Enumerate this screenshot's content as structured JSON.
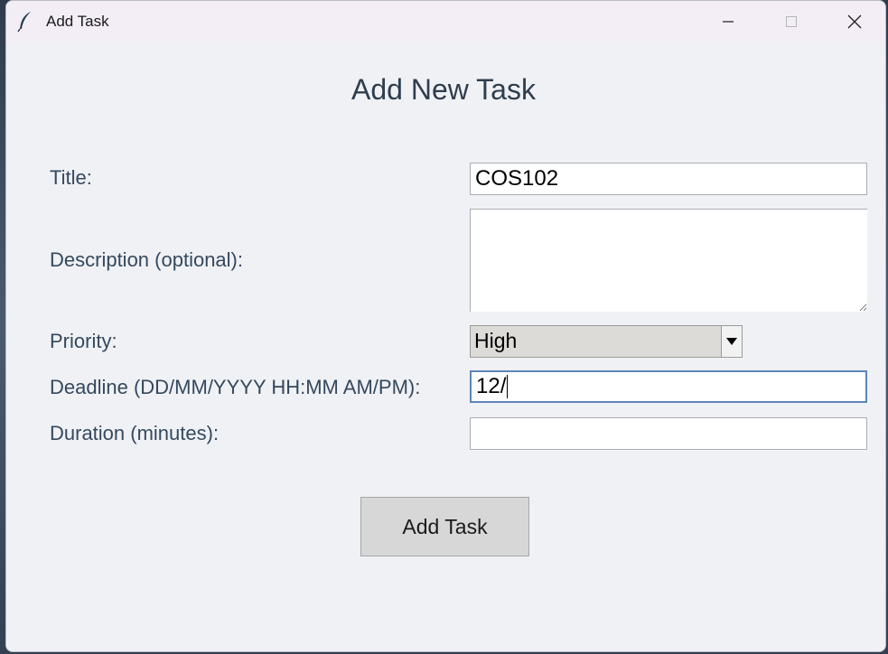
{
  "window": {
    "title": "Add Task",
    "icon": "feather-icon"
  },
  "form": {
    "heading": "Add New Task",
    "title_label": "Title:",
    "title_value": "COS102",
    "description_label": "Description (optional):",
    "description_value": "",
    "priority_label": "Priority:",
    "priority_value": "High",
    "deadline_label": "Deadline (DD/MM/YYYY HH:MM AM/PM):",
    "deadline_value": "12/",
    "duration_label": "Duration (minutes):",
    "duration_value": "",
    "submit_label": "Add Task"
  },
  "colors": {
    "label_text": "#34495e",
    "focus_border": "#5e84b8",
    "button_bg": "#d7d7d7",
    "window_bg": "#f0f1f5"
  }
}
